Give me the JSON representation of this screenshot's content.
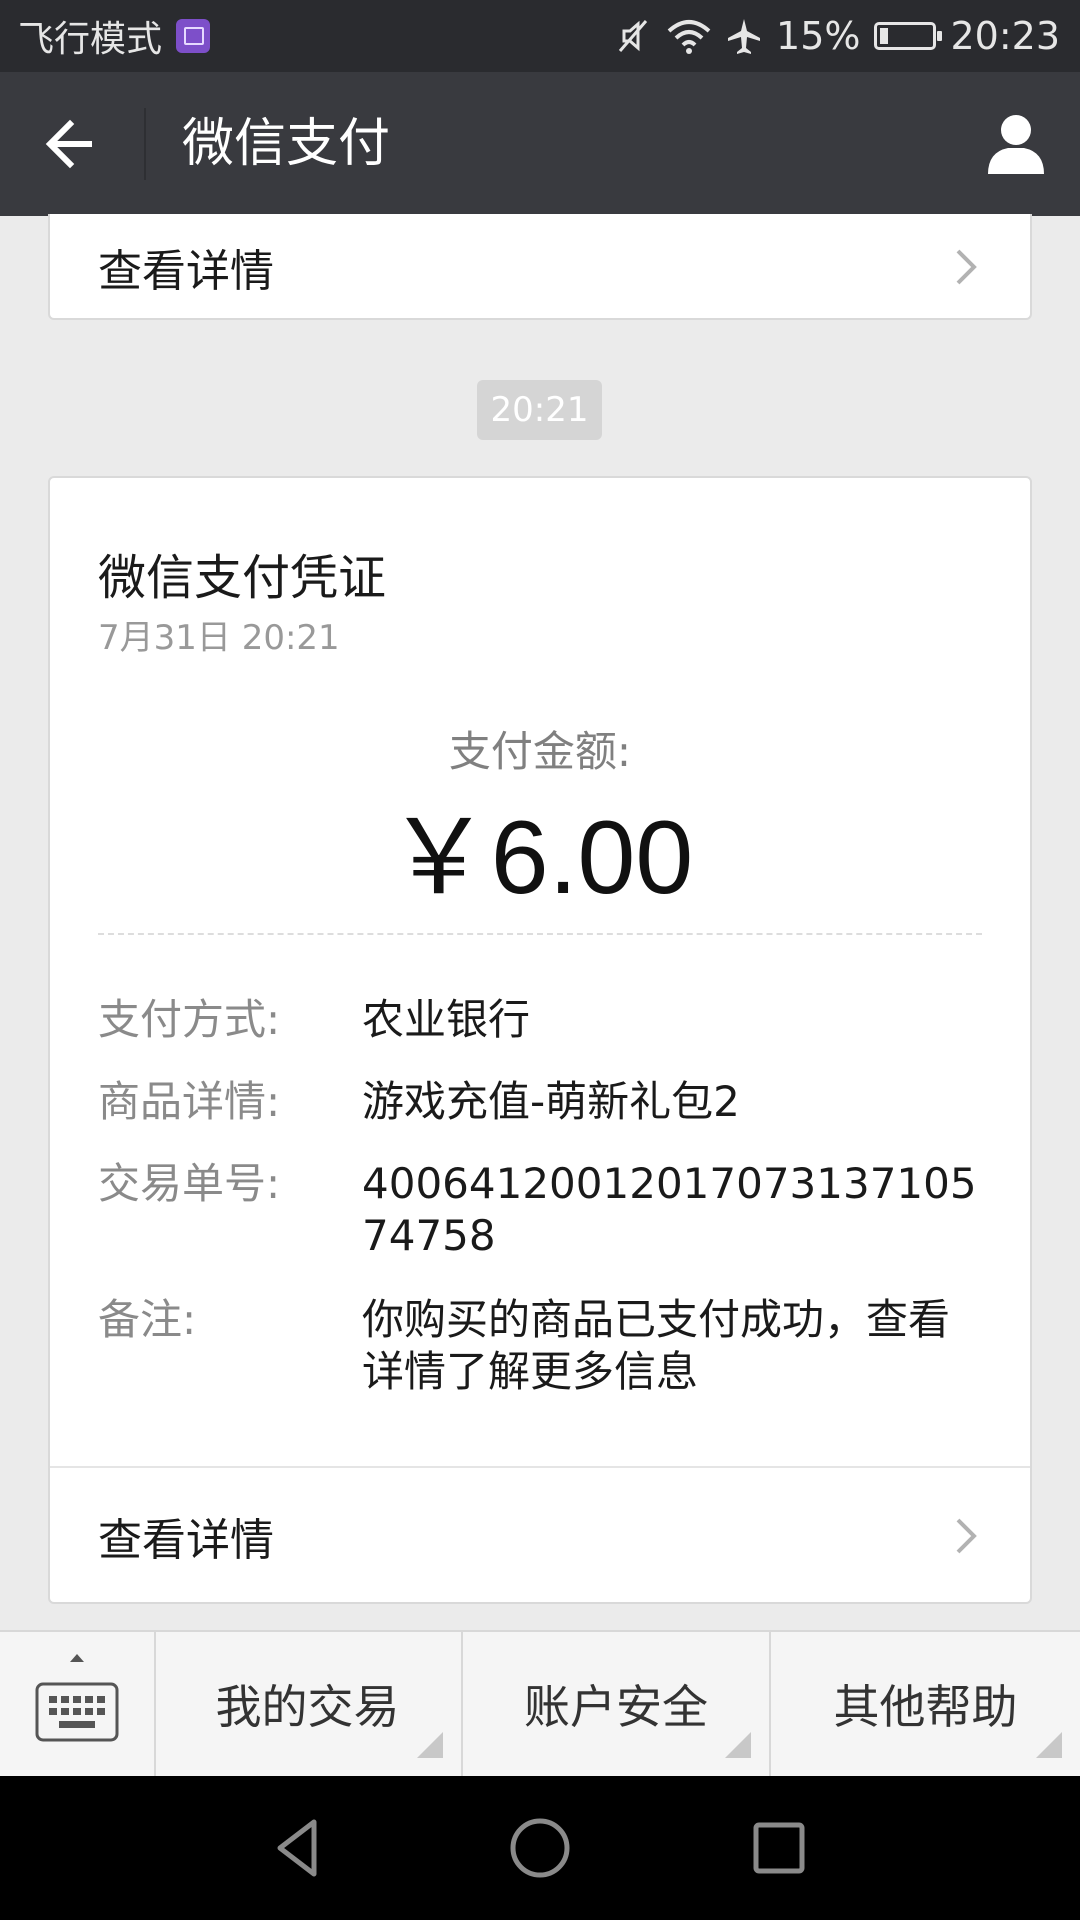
{
  "status_bar": {
    "left_text": "飞行模式",
    "battery": "15%",
    "battery_level": 0.15,
    "time": "20:23",
    "icons": [
      "gallery-icon",
      "mute-icon",
      "wifi-icon",
      "airplane-icon",
      "battery-icon"
    ]
  },
  "header": {
    "title": "微信支付",
    "icons": [
      "back-arrow-icon",
      "profile-icon"
    ]
  },
  "top_card": {
    "detail_label": "查看详情"
  },
  "timestamp": "20:21",
  "receipt": {
    "title": "微信支付凭证",
    "date": "7月31日  20:21",
    "amount_label": "支付金额:",
    "amount": "￥6.00",
    "rows": [
      {
        "label": "支付方式:",
        "value": "农业银行"
      },
      {
        "label": "商品详情:",
        "value": "游戏充值-萌新礼包2"
      },
      {
        "label": "交易单号:",
        "value": "4006412001201707313710574758"
      },
      {
        "label": "备注:",
        "value": "你购买的商品已支付成功，查看详情了解更多信息"
      }
    ],
    "detail_label": "查看详情"
  },
  "menu": {
    "items": [
      {
        "label": "我的交易"
      },
      {
        "label": "账户安全"
      },
      {
        "label": "其他帮助"
      }
    ]
  },
  "nav": {
    "icons": [
      "back-nav-icon",
      "home-nav-icon",
      "recents-nav-icon"
    ]
  },
  "colors": {
    "status_bar_bg": "#2a2b2f",
    "header_bg": "#393a3f",
    "page_bg": "#ebebeb",
    "card_bg": "#ffffff"
  }
}
